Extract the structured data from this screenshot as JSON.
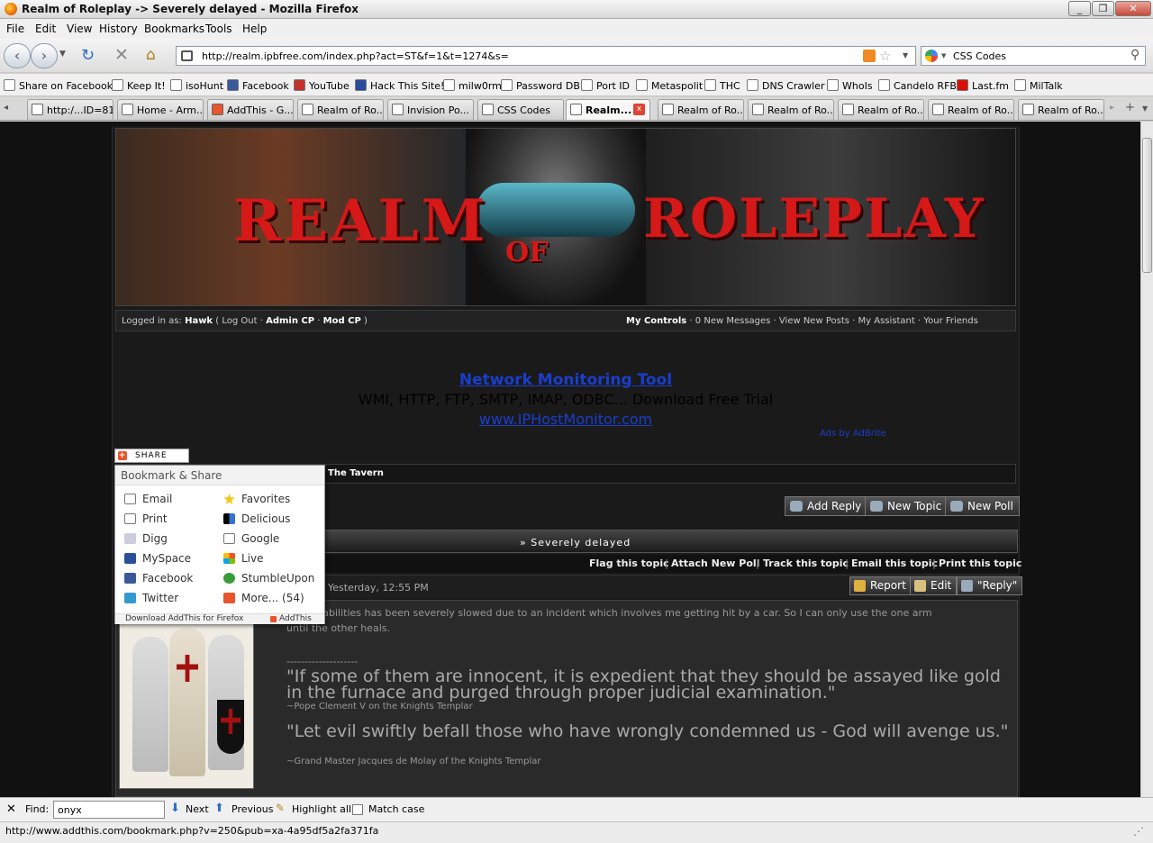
{
  "window": {
    "title": "Realm of Roleplay -> Severely delayed - Mozilla Firefox"
  },
  "menu": [
    "File",
    "Edit",
    "View",
    "History",
    "Bookmarks",
    "Tools",
    "Help"
  ],
  "nav": {
    "url": "http://realm.ipbfree.com/index.php?act=ST&f=1&t=1274&s=",
    "search": "CSS Codes"
  },
  "bookmarks": [
    "Share on Facebook",
    "Keep It!",
    "isoHunt",
    "Facebook",
    "YouTube",
    "Hack This Site!",
    "milw0rm",
    "Password DB",
    "Port ID",
    "Metaspolit",
    "THC",
    "DNS Crawler",
    "WhoIs",
    "Candelo RFB",
    "Last.fm",
    "MilTalk"
  ],
  "tabs": [
    "http:/...ID=81",
    "Home - Arm...",
    "AddThis - G...",
    "Realm of Ro...",
    "Invision Po...",
    "CSS Codes",
    "Realm...",
    "Realm of Ro...",
    "Realm of Ro...",
    "Realm of Ro...",
    "Realm of Ro...",
    "Realm of Ro..."
  ],
  "banner": {
    "w1": "REALM",
    "w2": "OF",
    "w3": "ROLEPLAY"
  },
  "userbar": {
    "logged_label": "Logged in as:",
    "user": "Hawk",
    "logout": "Log Out",
    "admin": "Admin CP",
    "mod": "Mod CP",
    "my_controls": "My Controls",
    "messages": "0 New Messages",
    "new_posts": "View New Posts",
    "assistant": "My Assistant",
    "friends": "Your Friends"
  },
  "ad": {
    "title": "Network Monitoring Tool",
    "desc": "WMI, HTTP, FTP, SMTP, IMAP, ODBC... Download Free Trial",
    "link": "www.IPHostMonitor.com",
    "ads_by": "Ads by AdBrite"
  },
  "share": {
    "button": "SHARE",
    "header": "Bookmark & Share",
    "left": [
      "Email",
      "Print",
      "Digg",
      "MySpace",
      "Facebook",
      "Twitter"
    ],
    "right": [
      "Favorites",
      "Delicious",
      "Google",
      "Live",
      "StumbleUpon",
      "More... (54)"
    ],
    "footer_left": "Download AddThis for Firefox",
    "footer_right": "AddThis"
  },
  "breadcrumb": "The Tavern",
  "actions": {
    "add_reply": "Add Reply",
    "new_topic": "New Topic",
    "new_poll": "New Poll"
  },
  "topic": {
    "title": "» Severely delayed",
    "tools": [
      "Flag this topic",
      "Attach New Poll",
      "Track this topic",
      "Email this topic",
      "Print this topic"
    ]
  },
  "post": {
    "date": "Yesterday, 12:55 PM",
    "buttons": [
      "Report",
      "Edit",
      "\"Reply\""
    ],
    "text1": "ing capabilities has been severely slowed due to an incident which involves me getting hit by a car. So I can only use the one arm",
    "text2": "until the other heals.",
    "sep": "--------------------",
    "quote1": "\"If some of them are innocent, it is expedient that they should be assayed like gold in the furnace and purged through proper judicial examination.\"",
    "attr1": "~Pope Clement V on the Knights Templar",
    "quote2": "\"Let evil swiftly befall those who have wrongly condemned us - God will avenge us.\"",
    "attr2": "~Grand Master Jacques de Molay of the Knights Templar"
  },
  "find": {
    "label": "Find:",
    "value": "onyx",
    "next": "Next",
    "previous": "Previous",
    "highlight": "Highlight all",
    "match": "Match case"
  },
  "status": "http://www.addthis.com/bookmark.php?v=250&pub=xa-4a95df5a2fa371fa"
}
